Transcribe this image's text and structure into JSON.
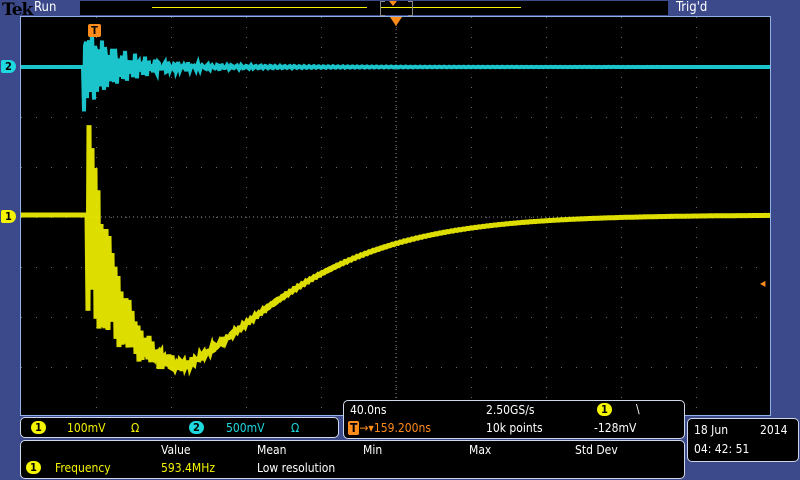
{
  "header": {
    "brand": "Tek",
    "run_state": "Run",
    "trigger_state": "Trig'd"
  },
  "channels": [
    {
      "id": "1",
      "scale": "100mV",
      "termination": "Ω",
      "color": "#f5f500"
    },
    {
      "id": "2",
      "scale": "500mV",
      "termination": "Ω",
      "color": "#1ed9e0"
    }
  ],
  "timebase": {
    "scale": "40.0ns",
    "sample_rate": "2.50GS/s",
    "delay": "159.200ns",
    "record_length": "10k points",
    "trigger_source": "1",
    "trigger_slope": "\\",
    "trigger_level": "-128mV"
  },
  "measurement": {
    "headers": [
      "Value",
      "Mean",
      "Min",
      "Max",
      "Std Dev"
    ],
    "rows": [
      {
        "source": "1",
        "name": "Frequency",
        "value": "593.4MHz",
        "mean": "Low resolution",
        "min": "",
        "max": "",
        "std": ""
      }
    ]
  },
  "datetime": {
    "date_day": "18 Jun",
    "year": "2014",
    "time": "04: 42: 51"
  },
  "markers": {
    "trigger": "T"
  },
  "colors": {
    "ch1": "#f5f500",
    "ch2": "#1ed9e0",
    "trigger": "#ff8c1a",
    "background": "#3c4a8c"
  }
}
